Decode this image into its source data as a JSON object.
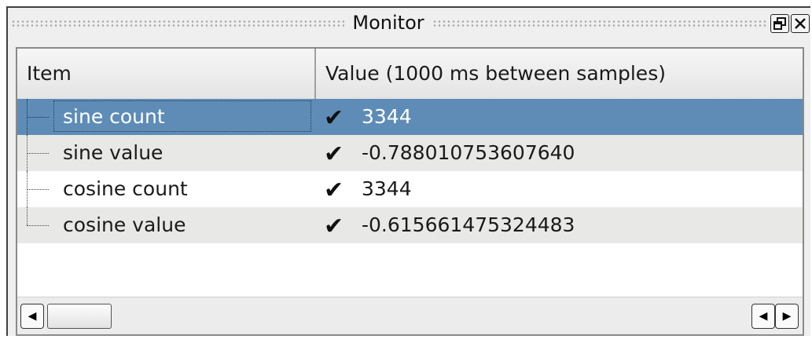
{
  "window": {
    "title": "Monitor",
    "float_icon": "float-window-icon",
    "close_icon": "close-icon"
  },
  "table": {
    "columns": [
      "Item",
      "Value (1000 ms between samples)"
    ],
    "rows": [
      {
        "name": "sine count",
        "value": "3344",
        "status_icon": "checkmark-icon",
        "selected": true
      },
      {
        "name": "sine value",
        "value": "-0.788010753607640",
        "status_icon": "checkmark-icon",
        "selected": false
      },
      {
        "name": "cosine count",
        "value": "3344",
        "status_icon": "checkmark-icon",
        "selected": false
      },
      {
        "name": "cosine value",
        "value": "-0.615661475324483",
        "status_icon": "checkmark-icon",
        "selected": false
      }
    ]
  },
  "scrollbar": {
    "left_icon": "arrow-left-icon",
    "right_icon": "arrow-right-icon"
  },
  "colors": {
    "selection": "#5e8cb6",
    "alternate_row": "#e8e8e6"
  }
}
